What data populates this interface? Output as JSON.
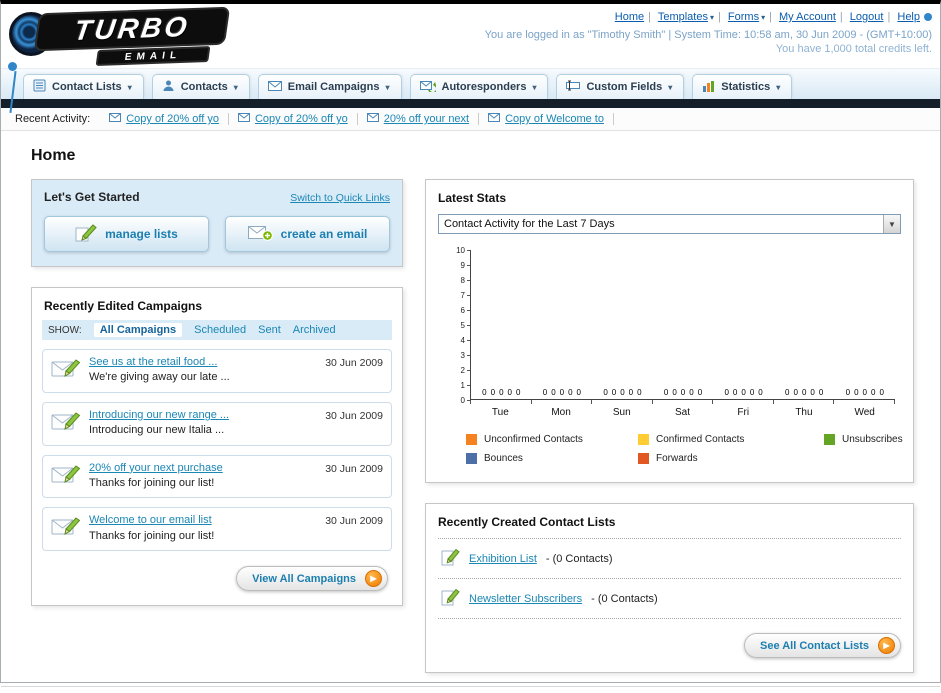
{
  "header": {
    "logo_primary": "TURBO",
    "logo_secondary": "EMAIL",
    "nav": {
      "home": "Home",
      "templates": "Templates",
      "forms": "Forms",
      "my_account": "My Account",
      "logout": "Logout",
      "help": "Help"
    },
    "login_info": "You are logged in as \"Timothy Smith\" | System Time: 10:58 am, 30 Jun 2009 - (GMT+10:00)",
    "credits": "You have 1,000 total credits left."
  },
  "nav_tabs": {
    "contact_lists": "Contact Lists",
    "contacts": "Contacts",
    "email_campaigns": "Email Campaigns",
    "autoresponders": "Autoresponders",
    "custom_fields": "Custom Fields",
    "statistics": "Statistics"
  },
  "recent_activity": {
    "label": "Recent Activity:",
    "items": [
      "Copy of 20% off yo",
      "Copy of 20% off yo",
      "20% off your next",
      "Copy of Welcome to"
    ]
  },
  "page_title": "Home",
  "get_started": {
    "title": "Let's Get Started",
    "switch_link": "Switch to Quick Links",
    "manage_lists_button": "manage lists",
    "create_email_button": "create an email"
  },
  "campaigns": {
    "title": "Recently Edited Campaigns",
    "show_label": "SHOW:",
    "filters": [
      "All Campaigns",
      "Scheduled",
      "Sent",
      "Archived"
    ],
    "items": [
      {
        "title": "See us at the retail food ...",
        "subtitle": "We're giving away our late ...",
        "date": "30 Jun 2009"
      },
      {
        "title": "Introducing our new range ...",
        "subtitle": "Introducing our new Italia ...",
        "date": "30 Jun 2009"
      },
      {
        "title": "20% off your next purchase",
        "subtitle": "Thanks for joining our list!",
        "date": "30 Jun 2009"
      },
      {
        "title": "Welcome to our email list",
        "subtitle": "Thanks for joining our list!",
        "date": "30 Jun 2009"
      }
    ],
    "view_all_button": "View All Campaigns"
  },
  "stats": {
    "title": "Latest Stats",
    "period_selector": "Contact Activity for the Last 7 Days"
  },
  "chart_data": {
    "type": "bar",
    "title": "Contact Activity for the Last 7 Days",
    "categories": [
      "Tue",
      "Mon",
      "Sun",
      "Sat",
      "Fri",
      "Thu",
      "Wed"
    ],
    "series": [
      {
        "name": "Unconfirmed Contacts",
        "color": "#F58220",
        "values": [
          0,
          0,
          0,
          0,
          0,
          0,
          0
        ]
      },
      {
        "name": "Confirmed Contacts",
        "color": "#FFCC33",
        "values": [
          0,
          0,
          0,
          0,
          0,
          0,
          0
        ]
      },
      {
        "name": "Unsubscribes",
        "color": "#64A525",
        "values": [
          0,
          0,
          0,
          0,
          0,
          0,
          0
        ]
      },
      {
        "name": "Bounces",
        "color": "#4D6FA8",
        "values": [
          0,
          0,
          0,
          0,
          0,
          0,
          0
        ]
      },
      {
        "name": "Forwards",
        "color": "#E25822",
        "values": [
          0,
          0,
          0,
          0,
          0,
          0,
          0
        ]
      }
    ],
    "ylim": [
      0,
      10
    ],
    "y_tick_step": 1,
    "grid": false,
    "legend_position": "bottom"
  },
  "contact_lists": {
    "title": "Recently Created Contact Lists",
    "items": [
      {
        "name": "Exhibition List",
        "detail": "- (0 Contacts)"
      },
      {
        "name": "Newsletter Subscribers",
        "detail": "- (0 Contacts)"
      }
    ],
    "see_all_button": "See All Contact Lists"
  }
}
